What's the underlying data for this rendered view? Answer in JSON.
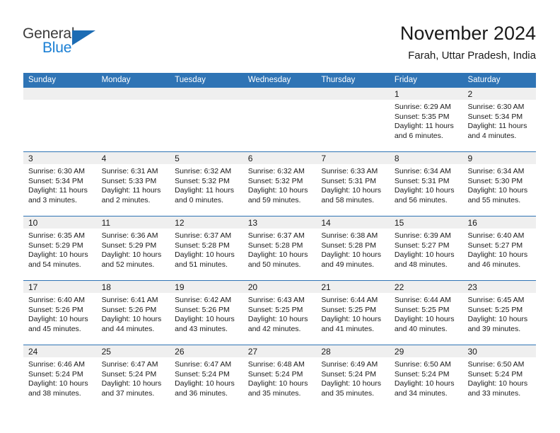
{
  "brand": {
    "name_part1": "General",
    "name_part2": "Blue",
    "accent_color": "#1a7fd4",
    "triangle_color": "#1c6cb4"
  },
  "header": {
    "title": "November 2024",
    "subtitle": "Farah, Uttar Pradesh, India",
    "header_bg_color": "#2f74b5",
    "numband_bg_color": "#efefef"
  },
  "weekdays": [
    "Sunday",
    "Monday",
    "Tuesday",
    "Wednesday",
    "Thursday",
    "Friday",
    "Saturday"
  ],
  "weeks": [
    [
      {
        "day": "",
        "empty": true,
        "lines": []
      },
      {
        "day": "",
        "empty": true,
        "lines": []
      },
      {
        "day": "",
        "empty": true,
        "lines": []
      },
      {
        "day": "",
        "empty": true,
        "lines": []
      },
      {
        "day": "",
        "empty": true,
        "lines": []
      },
      {
        "day": "1",
        "empty": false,
        "lines": [
          "Sunrise: 6:29 AM",
          "Sunset: 5:35 PM",
          "Daylight: 11 hours",
          "and 6 minutes."
        ]
      },
      {
        "day": "2",
        "empty": false,
        "lines": [
          "Sunrise: 6:30 AM",
          "Sunset: 5:34 PM",
          "Daylight: 11 hours",
          "and 4 minutes."
        ]
      }
    ],
    [
      {
        "day": "3",
        "empty": false,
        "lines": [
          "Sunrise: 6:30 AM",
          "Sunset: 5:34 PM",
          "Daylight: 11 hours",
          "and 3 minutes."
        ]
      },
      {
        "day": "4",
        "empty": false,
        "lines": [
          "Sunrise: 6:31 AM",
          "Sunset: 5:33 PM",
          "Daylight: 11 hours",
          "and 2 minutes."
        ]
      },
      {
        "day": "5",
        "empty": false,
        "lines": [
          "Sunrise: 6:32 AM",
          "Sunset: 5:32 PM",
          "Daylight: 11 hours",
          "and 0 minutes."
        ]
      },
      {
        "day": "6",
        "empty": false,
        "lines": [
          "Sunrise: 6:32 AM",
          "Sunset: 5:32 PM",
          "Daylight: 10 hours",
          "and 59 minutes."
        ]
      },
      {
        "day": "7",
        "empty": false,
        "lines": [
          "Sunrise: 6:33 AM",
          "Sunset: 5:31 PM",
          "Daylight: 10 hours",
          "and 58 minutes."
        ]
      },
      {
        "day": "8",
        "empty": false,
        "lines": [
          "Sunrise: 6:34 AM",
          "Sunset: 5:31 PM",
          "Daylight: 10 hours",
          "and 56 minutes."
        ]
      },
      {
        "day": "9",
        "empty": false,
        "lines": [
          "Sunrise: 6:34 AM",
          "Sunset: 5:30 PM",
          "Daylight: 10 hours",
          "and 55 minutes."
        ]
      }
    ],
    [
      {
        "day": "10",
        "empty": false,
        "lines": [
          "Sunrise: 6:35 AM",
          "Sunset: 5:29 PM",
          "Daylight: 10 hours",
          "and 54 minutes."
        ]
      },
      {
        "day": "11",
        "empty": false,
        "lines": [
          "Sunrise: 6:36 AM",
          "Sunset: 5:29 PM",
          "Daylight: 10 hours",
          "and 52 minutes."
        ]
      },
      {
        "day": "12",
        "empty": false,
        "lines": [
          "Sunrise: 6:37 AM",
          "Sunset: 5:28 PM",
          "Daylight: 10 hours",
          "and 51 minutes."
        ]
      },
      {
        "day": "13",
        "empty": false,
        "lines": [
          "Sunrise: 6:37 AM",
          "Sunset: 5:28 PM",
          "Daylight: 10 hours",
          "and 50 minutes."
        ]
      },
      {
        "day": "14",
        "empty": false,
        "lines": [
          "Sunrise: 6:38 AM",
          "Sunset: 5:28 PM",
          "Daylight: 10 hours",
          "and 49 minutes."
        ]
      },
      {
        "day": "15",
        "empty": false,
        "lines": [
          "Sunrise: 6:39 AM",
          "Sunset: 5:27 PM",
          "Daylight: 10 hours",
          "and 48 minutes."
        ]
      },
      {
        "day": "16",
        "empty": false,
        "lines": [
          "Sunrise: 6:40 AM",
          "Sunset: 5:27 PM",
          "Daylight: 10 hours",
          "and 46 minutes."
        ]
      }
    ],
    [
      {
        "day": "17",
        "empty": false,
        "lines": [
          "Sunrise: 6:40 AM",
          "Sunset: 5:26 PM",
          "Daylight: 10 hours",
          "and 45 minutes."
        ]
      },
      {
        "day": "18",
        "empty": false,
        "lines": [
          "Sunrise: 6:41 AM",
          "Sunset: 5:26 PM",
          "Daylight: 10 hours",
          "and 44 minutes."
        ]
      },
      {
        "day": "19",
        "empty": false,
        "lines": [
          "Sunrise: 6:42 AM",
          "Sunset: 5:26 PM",
          "Daylight: 10 hours",
          "and 43 minutes."
        ]
      },
      {
        "day": "20",
        "empty": false,
        "lines": [
          "Sunrise: 6:43 AM",
          "Sunset: 5:25 PM",
          "Daylight: 10 hours",
          "and 42 minutes."
        ]
      },
      {
        "day": "21",
        "empty": false,
        "lines": [
          "Sunrise: 6:44 AM",
          "Sunset: 5:25 PM",
          "Daylight: 10 hours",
          "and 41 minutes."
        ]
      },
      {
        "day": "22",
        "empty": false,
        "lines": [
          "Sunrise: 6:44 AM",
          "Sunset: 5:25 PM",
          "Daylight: 10 hours",
          "and 40 minutes."
        ]
      },
      {
        "day": "23",
        "empty": false,
        "lines": [
          "Sunrise: 6:45 AM",
          "Sunset: 5:25 PM",
          "Daylight: 10 hours",
          "and 39 minutes."
        ]
      }
    ],
    [
      {
        "day": "24",
        "empty": false,
        "lines": [
          "Sunrise: 6:46 AM",
          "Sunset: 5:24 PM",
          "Daylight: 10 hours",
          "and 38 minutes."
        ]
      },
      {
        "day": "25",
        "empty": false,
        "lines": [
          "Sunrise: 6:47 AM",
          "Sunset: 5:24 PM",
          "Daylight: 10 hours",
          "and 37 minutes."
        ]
      },
      {
        "day": "26",
        "empty": false,
        "lines": [
          "Sunrise: 6:47 AM",
          "Sunset: 5:24 PM",
          "Daylight: 10 hours",
          "and 36 minutes."
        ]
      },
      {
        "day": "27",
        "empty": false,
        "lines": [
          "Sunrise: 6:48 AM",
          "Sunset: 5:24 PM",
          "Daylight: 10 hours",
          "and 35 minutes."
        ]
      },
      {
        "day": "28",
        "empty": false,
        "lines": [
          "Sunrise: 6:49 AM",
          "Sunset: 5:24 PM",
          "Daylight: 10 hours",
          "and 35 minutes."
        ]
      },
      {
        "day": "29",
        "empty": false,
        "lines": [
          "Sunrise: 6:50 AM",
          "Sunset: 5:24 PM",
          "Daylight: 10 hours",
          "and 34 minutes."
        ]
      },
      {
        "day": "30",
        "empty": false,
        "lines": [
          "Sunrise: 6:50 AM",
          "Sunset: 5:24 PM",
          "Daylight: 10 hours",
          "and 33 minutes."
        ]
      }
    ]
  ]
}
